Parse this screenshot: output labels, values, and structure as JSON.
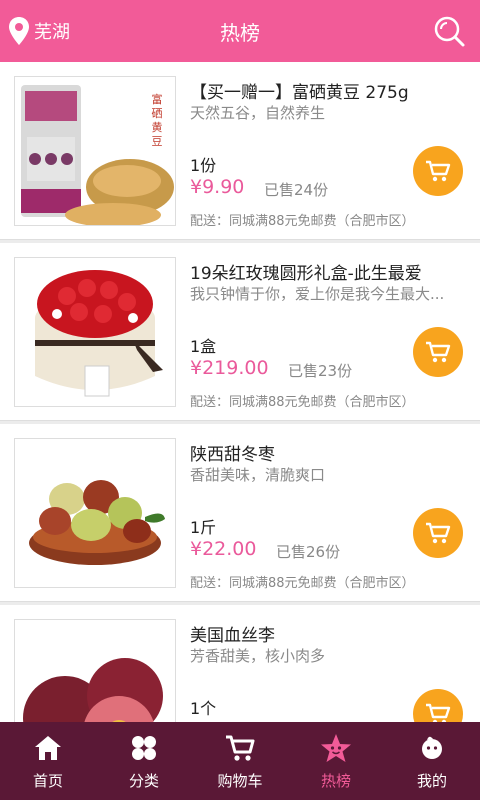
{
  "header": {
    "location": "芜湖",
    "title": "热榜",
    "location_icon": "location-pin-icon",
    "search_icon": "search-icon"
  },
  "colors": {
    "accent": "#f25b98",
    "price": "#ea5a9b",
    "cart_button": "#f8a41e",
    "tabbar": "#5a1836"
  },
  "products": [
    {
      "name": "【买一赠一】富硒黄豆  275g",
      "desc": "天然五谷，自然养生",
      "unit": "1份",
      "price": "¥9.90",
      "sold": "已售24份",
      "shipping": "配送：同城满88元免邮费（合肥市区）"
    },
    {
      "name": "19朵红玫瑰圆形礼盒-此生最爱",
      "desc": "我只钟情于你，爱上你是我今生最大...",
      "unit": "1盒",
      "price": "¥219.00",
      "sold": "已售23份",
      "shipping": "配送：同城满88元免邮费（合肥市区）"
    },
    {
      "name": "陕西甜冬枣",
      "desc": "香甜美味，清脆爽口",
      "unit": "1斤",
      "price": "¥22.00",
      "sold": "已售26份",
      "shipping": "配送：同城满88元免邮费（合肥市区）"
    },
    {
      "name": "美国血丝李",
      "desc": "芳香甜美，核小肉多",
      "unit": "1个",
      "price": "",
      "sold": "",
      "shipping": ""
    }
  ],
  "tabs": [
    {
      "label": "首页",
      "icon": "home-icon"
    },
    {
      "label": "分类",
      "icon": "category-icon"
    },
    {
      "label": "购物车",
      "icon": "cart-icon"
    },
    {
      "label": "热榜",
      "icon": "star-icon",
      "active": true
    },
    {
      "label": "我的",
      "icon": "profile-icon"
    }
  ]
}
